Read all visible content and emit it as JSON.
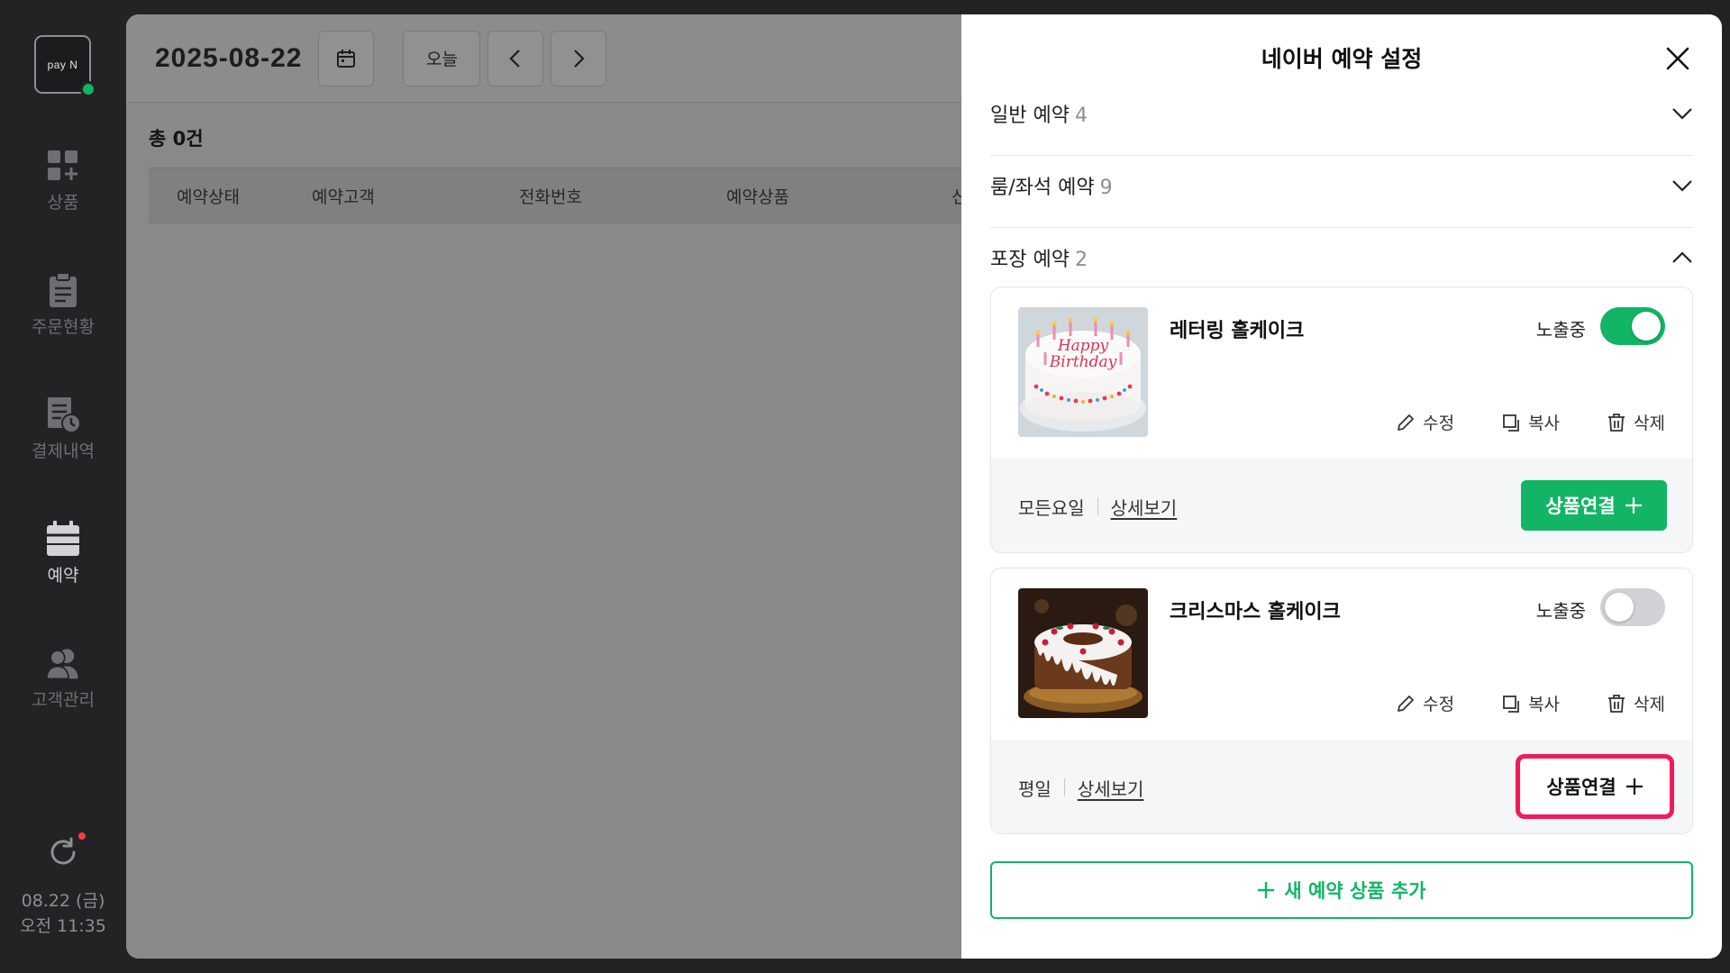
{
  "sidebar": {
    "logo": "pay N",
    "items": [
      {
        "label": "상품",
        "icon": "product-grid-icon"
      },
      {
        "label": "주문현황",
        "icon": "clipboard-icon"
      },
      {
        "label": "결제내역",
        "icon": "receipt-clock-icon"
      },
      {
        "label": "예약",
        "icon": "calendar-icon",
        "active": true
      },
      {
        "label": "고객관리",
        "icon": "people-icon"
      }
    ],
    "date_line": "08.22 (금)",
    "time_line": "오전 11:35"
  },
  "main": {
    "date": "2025-08-22",
    "today_label": "오늘",
    "count_label": "총 0건",
    "columns": [
      "예약상태",
      "예약고객",
      "전화번호",
      "예약상품",
      "신"
    ]
  },
  "panel": {
    "title": "네이버 예약 설정",
    "sections": [
      {
        "label": "일반 예약",
        "count": "4",
        "expanded": false
      },
      {
        "label": "룸/좌석 예약",
        "count": "9",
        "expanded": false
      },
      {
        "label": "포장 예약",
        "count": "2",
        "expanded": true
      }
    ],
    "products": [
      {
        "name": "레터링 홀케이크",
        "visibility_label": "노출중",
        "visible": true,
        "edit_label": "수정",
        "copy_label": "복사",
        "delete_label": "삭제",
        "days": "모든요일",
        "detail_label": "상세보기",
        "link_label": "상품연결"
      },
      {
        "name": "크리스마스 홀케이크",
        "visibility_label": "노출중",
        "visible": false,
        "edit_label": "수정",
        "copy_label": "복사",
        "delete_label": "삭제",
        "days": "평일",
        "detail_label": "상세보기",
        "link_label": "상품연결"
      }
    ],
    "add_new_label": "새 예약 상품 추가"
  },
  "colors": {
    "accent_green": "#12b565",
    "highlight_pink": "#ee1c5b",
    "toggle_off": "#d1d1d6"
  }
}
